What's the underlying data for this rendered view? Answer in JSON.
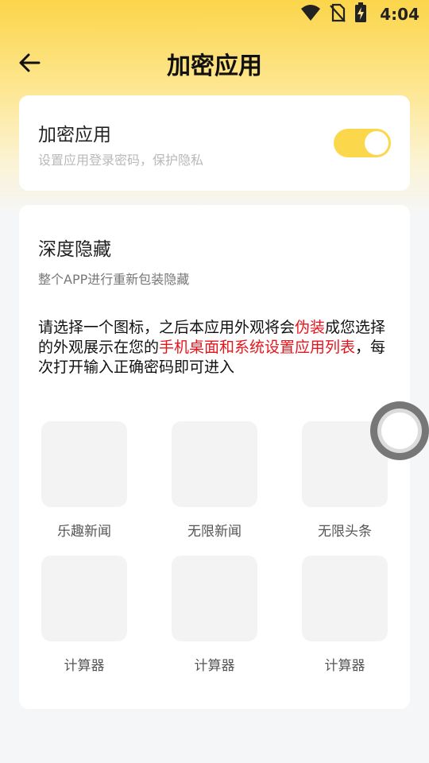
{
  "status_bar": {
    "time": "4:04",
    "icons": [
      "wifi-icon",
      "no-sim-icon",
      "battery-charging-icon"
    ]
  },
  "header": {
    "title": "加密应用",
    "back_icon": "arrow-left-icon"
  },
  "encrypt_card": {
    "title": "加密应用",
    "subtitle": "设置应用登录密码，保护隐私",
    "toggle_on": true,
    "toggle_color": "#fbd84b"
  },
  "hide_card": {
    "title": "深度隐藏",
    "subtitle": "整个APP进行重新包装隐藏",
    "description": {
      "part1": "请选择一个图标，之后本应用外观将会",
      "highlight1": "伪装",
      "part2": "成您选择的外观展示在您的",
      "highlight2": "手机桌面和系统设置应用列表",
      "part3": "，每次打开输入正确密码即可进入"
    },
    "icons": [
      {
        "label": "乐趣新闻"
      },
      {
        "label": "无限新闻"
      },
      {
        "label": "无限头条"
      },
      {
        "label": "计算器"
      },
      {
        "label": "计算器"
      },
      {
        "label": "计算器"
      }
    ],
    "highlight_color": "#e8141c"
  }
}
